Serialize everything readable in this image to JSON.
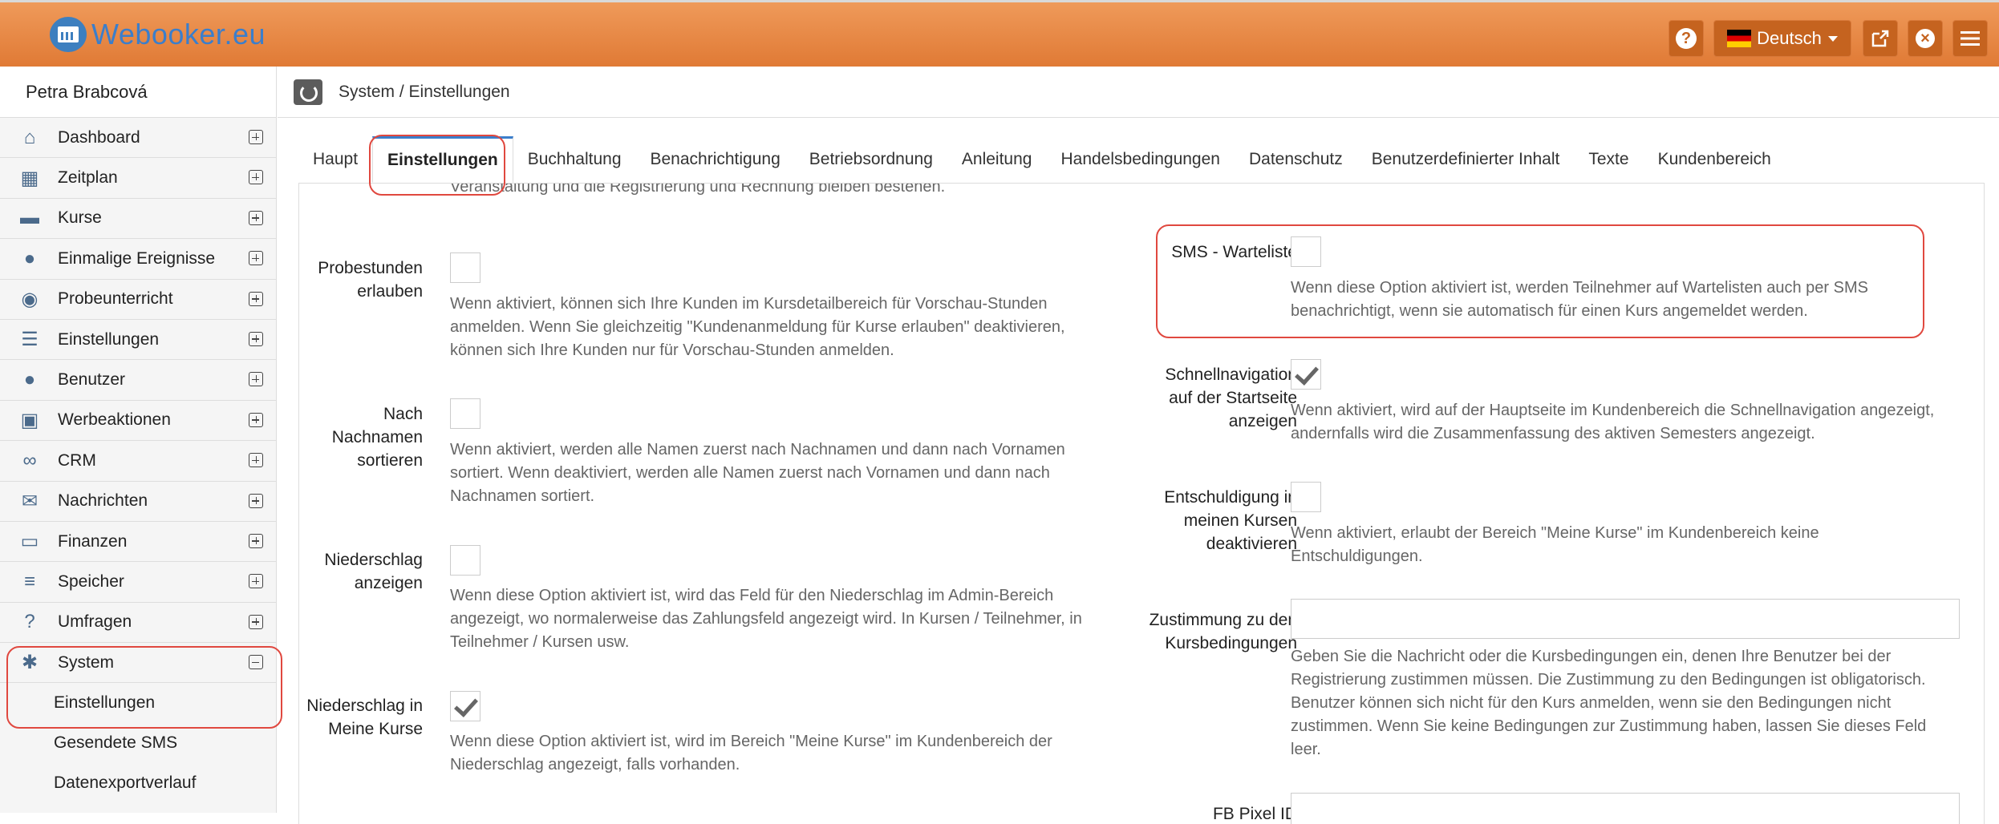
{
  "app": {
    "title": "Webooker.eu"
  },
  "topbar": {
    "language": "Deutsch",
    "help_icon": "question-icon",
    "external_icon": "external-link-icon",
    "close_icon": "close-icon",
    "menu_icon": "hamburger-icon"
  },
  "sidebar": {
    "user": "Petra Brabcová",
    "items": [
      {
        "label": "Dashboard",
        "icon": "home-icon"
      },
      {
        "label": "Zeitplan",
        "icon": "calendar-icon"
      },
      {
        "label": "Kurse",
        "icon": "book-icon"
      },
      {
        "label": "Einmalige Ereignisse",
        "icon": "soccer-icon"
      },
      {
        "label": "Probeunterricht",
        "icon": "eye-slash-icon"
      },
      {
        "label": "Einstellungen",
        "icon": "tasks-icon"
      },
      {
        "label": "Benutzer",
        "icon": "users-icon"
      },
      {
        "label": "Werbeaktionen",
        "icon": "gift-icon"
      },
      {
        "label": "CRM",
        "icon": "handshake-icon"
      },
      {
        "label": "Nachrichten",
        "icon": "envelope-icon"
      },
      {
        "label": "Finanzen",
        "icon": "money-icon"
      },
      {
        "label": "Speicher",
        "icon": "database-icon"
      },
      {
        "label": "Umfragen",
        "icon": "question-icon"
      },
      {
        "label": "System",
        "icon": "cogs-icon"
      }
    ],
    "system_sub": [
      "Einstellungen",
      "Gesendete SMS",
      "Datenexportverlauf"
    ]
  },
  "breadcrumb": "System / Einstellungen",
  "tabs": [
    "Haupt",
    "Einstellungen",
    "Buchhaltung",
    "Benachrichtigung",
    "Betriebsordnung",
    "Anleitung",
    "Handelsbedingungen",
    "Datenschutz",
    "Benutzerdefinierter Inhalt",
    "Texte",
    "Kundenbereich"
  ],
  "left": {
    "top_cut": "Veranstaltung und die Registrierung und Rechnung bleiben bestehen.",
    "probestunden": {
      "label": "Probestunden erlauben",
      "checked": false,
      "hint": "Wenn aktiviert, können sich Ihre Kunden im Kursdetailbereich für Vorschau-Stunden anmelden. Wenn Sie gleichzeitig \"Kundenanmeldung für Kurse erlauben\" deaktivieren, können sich Ihre Kunden nur für Vorschau-Stunden anmelden."
    },
    "nachnamen": {
      "label": "Nach Nachnamen sortieren",
      "checked": false,
      "hint": "Wenn aktiviert, werden alle Namen zuerst nach Nachnamen und dann nach Vornamen sortiert. Wenn deaktiviert, werden alle Namen zuerst nach Vornamen und dann nach Nachnamen sortiert."
    },
    "niederschlag": {
      "label": "Niederschlag anzeigen",
      "checked": false,
      "hint": "Wenn diese Option aktiviert ist, wird das Feld für den Niederschlag im Admin-Bereich angezeigt, wo normalerweise das Zahlungsfeld angezeigt wird. In Kursen / Teilnehmer, in Teilnehmer / Kursen usw."
    },
    "niederschlag_kurse": {
      "label": "Niederschlag in Meine Kurse",
      "checked": true,
      "hint": "Wenn diese Option aktiviert ist, wird im Bereich \"Meine Kurse\" im Kundenbereich der Niederschlag angezeigt, falls vorhanden."
    }
  },
  "right": {
    "sms": {
      "label": "SMS - Warteliste",
      "checked": false,
      "hint": "Wenn diese Option aktiviert ist, werden Teilnehmer auf Wartelisten auch per SMS benachrichtigt, wenn sie automatisch für einen Kurs angemeldet werden."
    },
    "schnell": {
      "label": "Schnellnavigation auf der Startseite anzeigen",
      "checked": true,
      "hint": "Wenn aktiviert, wird auf der Hauptseite im Kundenbereich die Schnellnavigation angezeigt, andernfalls wird die Zusammenfassung des aktiven Semesters angezeigt."
    },
    "entschuldigung": {
      "label": "Entschuldigung in meinen Kursen deaktivieren",
      "checked": false,
      "hint": "Wenn aktiviert, erlaubt der Bereich \"Meine Kurse\" im Kundenbereich keine Entschuldigungen."
    },
    "zustimmung": {
      "label": "Zustimmung zu den Kursbedingungen",
      "value": "",
      "hint": "Geben Sie die Nachricht oder die Kursbedingungen ein, denen Ihre Benutzer bei der Registrierung zustimmen müssen. Die Zustimmung zu den Bedingungen ist obligatorisch. Benutzer können sich nicht für den Kurs anmelden, wenn sie den Bedingungen nicht zustimmen. Wenn Sie keine Bedingungen zur Zustimmung haben, lassen Sie dieses Feld leer."
    },
    "fb": {
      "label": "FB Pixel ID"
    }
  },
  "colors": {
    "header": "#e8853f",
    "accent": "#3b7ecb",
    "annotation": "#e0483f"
  }
}
